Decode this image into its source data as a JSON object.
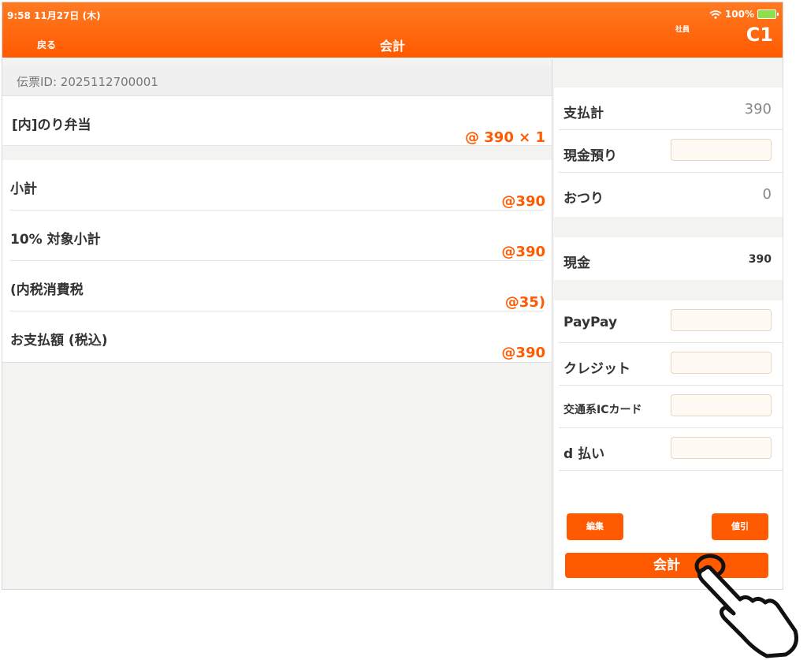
{
  "status_bar": {
    "time_date": "9:58   11月27日 (木)",
    "battery": "100%"
  },
  "header": {
    "back_label": "戻る",
    "title": "会計",
    "user_role": "社員",
    "table_code": "C1"
  },
  "ticket": {
    "id_label": "伝票ID: 2025112700001"
  },
  "items": [
    {
      "name": "[内]のり弁当",
      "price_qty": "@ 390 × 1"
    }
  ],
  "totals": [
    {
      "label": "小計",
      "value": "@390"
    },
    {
      "label": "10% 対象小計",
      "value": "@390"
    },
    {
      "label": "(内税消費税",
      "value": "@35)"
    },
    {
      "label": "お支払額 (税込)",
      "value": "@390"
    }
  ],
  "payment": {
    "total": {
      "label": "支払計",
      "value": "390"
    },
    "cash_received": {
      "label": "現金預り",
      "value": ""
    },
    "change": {
      "label": "おつり",
      "value": "0"
    },
    "cash": {
      "label": "現金",
      "value": "390"
    },
    "methods": [
      {
        "label": "PayPay",
        "value": ""
      },
      {
        "label": "クレジット",
        "value": ""
      },
      {
        "label": "交通系ICカード",
        "value": ""
      },
      {
        "label": "d 払い",
        "value": ""
      }
    ]
  },
  "buttons": {
    "edit": "編集",
    "discount": "値引",
    "checkout": "会計"
  },
  "colors": {
    "accent": "#ff5a00",
    "header_top": "#ff7a22",
    "input_bg": "#fffaf3"
  }
}
